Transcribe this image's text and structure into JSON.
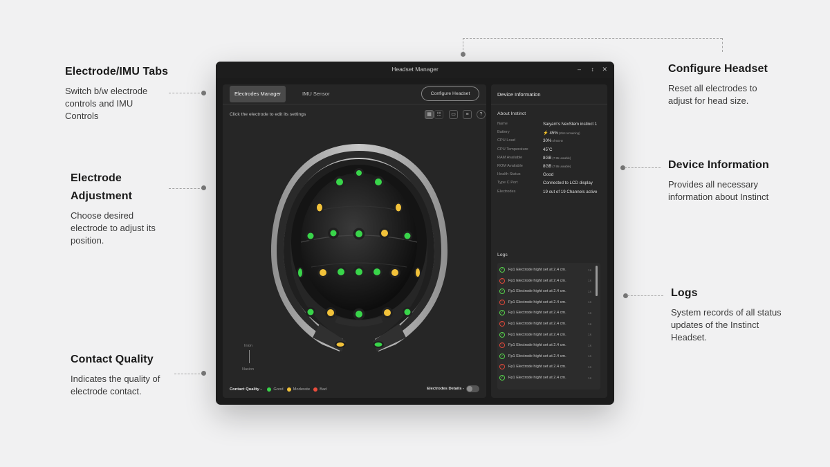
{
  "callouts": {
    "tabs": {
      "title": "Electrode/IMU Tabs",
      "desc": "Switch b/w electrode controls and IMU Controls"
    },
    "adjust": {
      "title": "Electrode Adjustment",
      "desc": "Choose desired electrode to adjust its position."
    },
    "contact": {
      "title": "Contact Quality",
      "desc": "Indicates the quality of electrode contact."
    },
    "configure": {
      "title": "Configure Headset",
      "desc": "Reset all electrodes to adjust for head size."
    },
    "device": {
      "title": "Device Information",
      "desc": "Provides all necessary information about Instinct"
    },
    "logs": {
      "title": "Logs",
      "desc": "System records of all status updates of the Instinct Headset."
    }
  },
  "window": {
    "title": "Headset Manager",
    "controls": {
      "minimize": "–",
      "resize": "↕",
      "close": "✕"
    }
  },
  "tabs": {
    "electrodes": "Electrodes Manager",
    "imu": "IMU Sensor"
  },
  "configure_button": "Configure Headset",
  "hint": "Click the electrode to edit its settings",
  "toolbar_icons": [
    "grid-view-icon",
    "list-view-icon",
    "monitor-icon",
    "sliders-icon",
    "help-icon"
  ],
  "axis": {
    "top": "Inion",
    "bottom": "Nasion"
  },
  "legend": {
    "label": "Contact Quality -",
    "good": "Good",
    "moderate": "Moderate",
    "bad": "Bad"
  },
  "electrode_details_label": "Electrodes Details -",
  "colors": {
    "good": "#39d54a",
    "moderate": "#f2c23a",
    "bad": "#ea4c3c",
    "window_bg": "#1b1b1b",
    "panel_bg": "#262626"
  },
  "device_info": {
    "header": "Device Information",
    "about_title": "About Instinct",
    "rows": [
      {
        "key": "Name",
        "value": "Saiyam's NexStem instinct 1"
      },
      {
        "key": "Battery",
        "value": "45%",
        "note": "(8hrs remaining)"
      },
      {
        "key": "CPU Load",
        "value": "30%",
        "note": "of 6GHz"
      },
      {
        "key": "CPU Temperature",
        "value": "45˚C"
      },
      {
        "key": "RAM Available",
        "value": "8GB",
        "note": "(7.95 useable)"
      },
      {
        "key": "ROM Available",
        "value": "8GB",
        "note": "(7.95 useable)"
      },
      {
        "key": "Health Status",
        "value": "Good"
      },
      {
        "key": "Type C Port",
        "value": "Connected to LCD display"
      },
      {
        "key": "Electrodes",
        "value": "19 out of 19 Channels active"
      }
    ]
  },
  "logs": {
    "label": "Logs",
    "entries": [
      {
        "status": "ok",
        "text": "Fp1 Electrode hight set at 2.4 cm.",
        "time": "1s"
      },
      {
        "status": "err",
        "text": "Fp1 Electrode hight set at 2.4 cm.",
        "time": "1s"
      },
      {
        "status": "ok",
        "text": "Fp1 Electrode hight set at 2.4 cm.",
        "time": "1s"
      },
      {
        "status": "err",
        "text": "Fp1 Electrode hight set at 2.4 cm.",
        "time": "1s"
      },
      {
        "status": "ok",
        "text": "Fp1 Electrode hight set at 2.4 cm.",
        "time": "1s"
      },
      {
        "status": "err",
        "text": "Fp1 Electrode hight set at 2.4 cm.",
        "time": "1s"
      },
      {
        "status": "ok",
        "text": "Fp1 Electrode hight set at 2.4 cm.",
        "time": "1s"
      },
      {
        "status": "err",
        "text": "Fp1 Electrode hight set at 2.4 cm.",
        "time": "1s"
      },
      {
        "status": "ok",
        "text": "Fp1 Electrode hight set at 2.4 cm.",
        "time": "1s"
      },
      {
        "status": "err",
        "text": "Fp1 Electrode hight set at 2.4 cm.",
        "time": "1s"
      },
      {
        "status": "ok",
        "text": "Fp1 Electrode hight set at 2.4 cm.",
        "time": "1s"
      }
    ]
  }
}
